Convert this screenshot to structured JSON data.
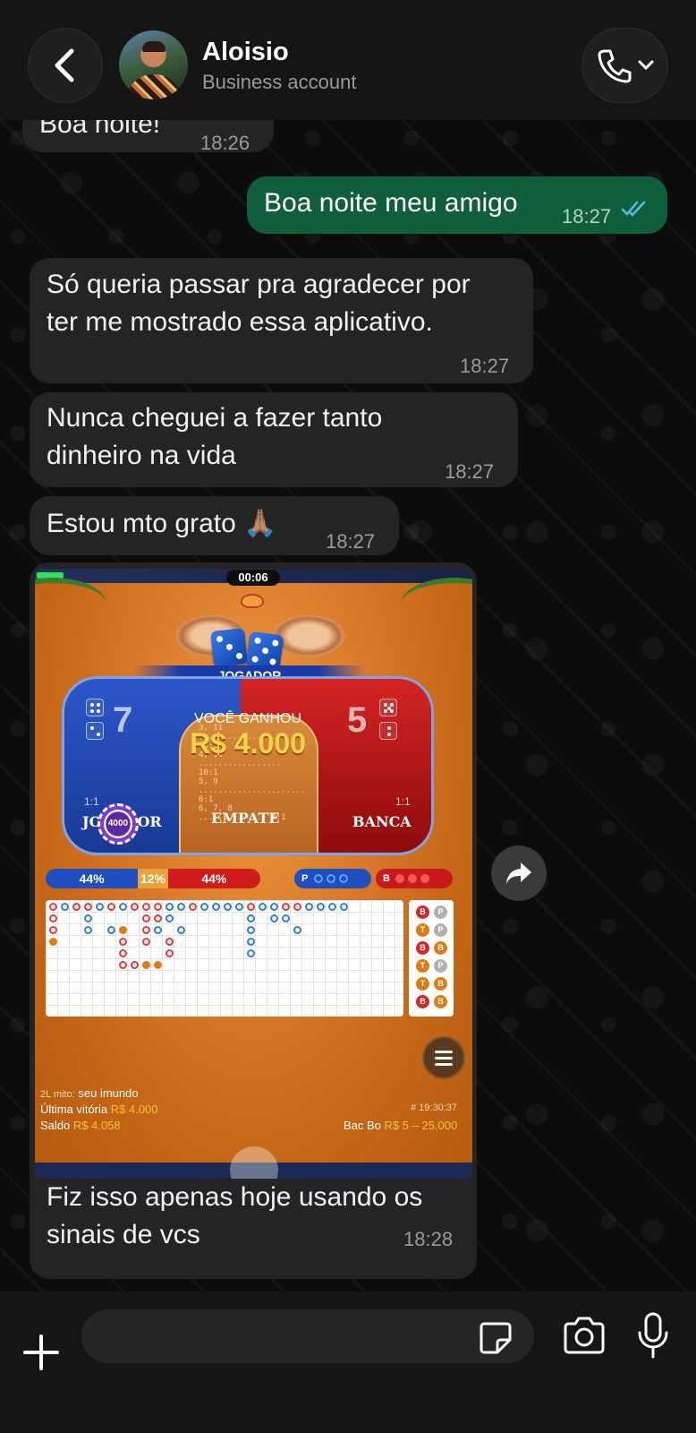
{
  "header": {
    "contact_name": "Aloisio",
    "contact_subtitle": "Business account"
  },
  "messages": [
    {
      "direction": "in",
      "text": "Boa noite!",
      "time": "18:26"
    },
    {
      "direction": "out",
      "text": "Boa noite meu amigo",
      "time": "18:27",
      "status": "read"
    },
    {
      "direction": "in",
      "text": "Só queria passar pra agradecer por\nter me mostrado essa aplicativo.",
      "time": "18:27"
    },
    {
      "direction": "in",
      "text": "Nunca cheguei a fazer tanto\ndinheiro na vida",
      "time": "18:27"
    },
    {
      "direction": "in",
      "text": "Estou mto grato 🙏🏽",
      "time": "18:27"
    },
    {
      "direction": "in",
      "text": "Fiz isso apenas hoje usando os\nsinais de vcs",
      "time": "18:28",
      "has_image": true
    }
  ],
  "game_image": {
    "timer": "00:06",
    "jogador_banner": "JOGADOR",
    "win_title": "VOCÊ GANHOU",
    "win_amount": "R$ 4.000",
    "player_score": "7",
    "banker_score": "5",
    "payouts": [
      "3, 11 ................. 25:1",
      "4, 10 ................. 10:1",
      "5, 9 ...................... 6:1",
      "6, 7, 8 .............. 4:1"
    ],
    "player_ratio": "1:1",
    "banker_ratio": "1:1",
    "player_label": "JOGADOR",
    "tie_label": "EMPATE",
    "banker_label": "BANCA",
    "chip_value": "4000",
    "pct_player": "44%",
    "pct_tie": "12%",
    "pct_banker": "44%",
    "pill_p": "P",
    "pill_b": "B",
    "history": [
      {
        "left": "B",
        "left_color": "#d62828",
        "right": "P"
      },
      {
        "left": "T",
        "left_color": "#e07b12",
        "right": "P"
      },
      {
        "left": "B",
        "left_color": "#d62828",
        "right": "B"
      },
      {
        "left": "T",
        "left_color": "#e07b12",
        "right": "P"
      },
      {
        "left": "T",
        "left_color": "#e07b12",
        "right": "B"
      },
      {
        "left": "B",
        "left_color": "#d62828",
        "right": "B"
      }
    ],
    "user_prefix": "2L mito:",
    "user_name": "seu imundo",
    "last_win_label": "Última vitória",
    "last_win_value": "R$ 4.000",
    "balance_label": "Saldo",
    "balance_value": "R$ 4.058",
    "round_id": "# 19:30:37",
    "table_name": "Bac Bo",
    "table_limits": "R$ 5 – 25.000"
  },
  "input": {
    "placeholder": ""
  },
  "icons": {
    "back": "chevron-left-icon",
    "call": "phone-icon",
    "forward": "forward-icon",
    "plus": "plus-icon",
    "sticker": "sticker-icon",
    "camera": "camera-icon",
    "mic": "microphone-icon"
  },
  "colors": {
    "outgoing_bubble": "#0f5f3d",
    "incoming_bubble": "#242424",
    "read_ticks": "#53bdeb"
  }
}
